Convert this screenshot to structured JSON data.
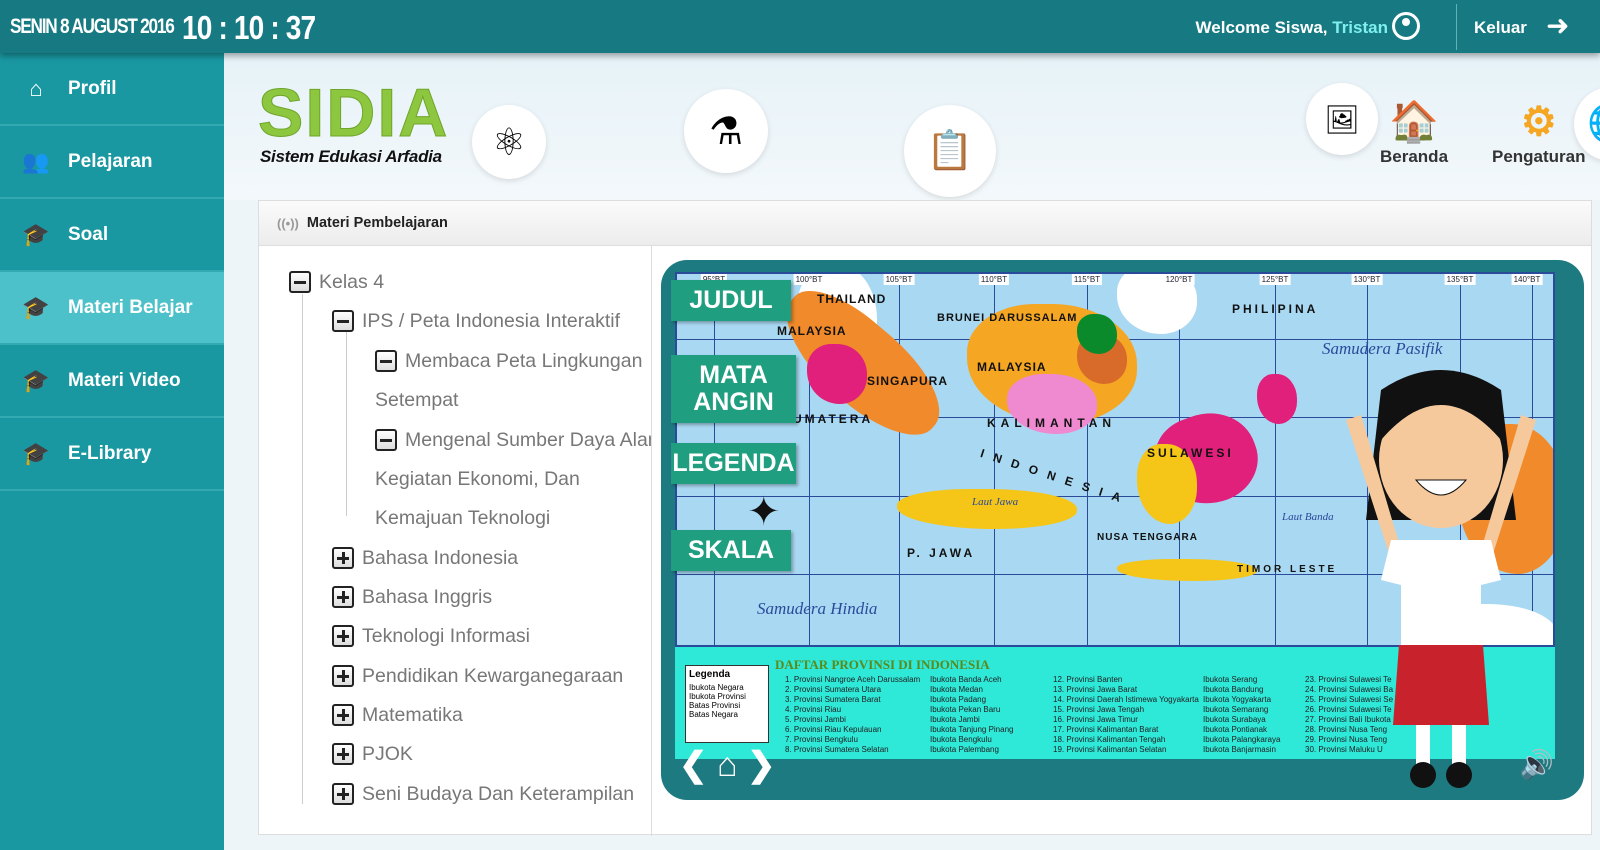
{
  "topbar": {
    "date": "SENIN 8 AUGUST 2016",
    "time": "10 : 10 : 37",
    "welcome_prefix": "Welcome Siswa, ",
    "user_name": "Tristan",
    "logout_label": "Keluar"
  },
  "sidebar": {
    "items": [
      {
        "label": "Profil",
        "icon": "home-icon"
      },
      {
        "label": "Pelajaran",
        "icon": "users-icon"
      },
      {
        "label": "Soal",
        "icon": "graduation-cap-icon"
      },
      {
        "label": "Materi Belajar",
        "icon": "graduation-cap-icon",
        "active": true
      },
      {
        "label": "Materi Video",
        "icon": "graduation-cap-icon"
      },
      {
        "label": "E-Library",
        "icon": "graduation-cap-icon"
      }
    ]
  },
  "header": {
    "logo": "SIDIA",
    "tagline": "Sistem Edukasi Arfadia",
    "nav": [
      {
        "label": "Beranda",
        "icon": "house-icon"
      },
      {
        "label": "Pengaturan",
        "icon": "gear-icon"
      }
    ]
  },
  "panel": {
    "title": "Materi Pembelajaran",
    "tree": [
      {
        "label": "Kelas 4",
        "state": "expanded",
        "level": 0
      },
      {
        "label": "IPS / Peta Indonesia Interaktif",
        "state": "expanded",
        "level": 1
      },
      {
        "label": "Membaca Peta Lingkungan",
        "state": "expanded",
        "level": 2
      },
      {
        "label": "Setempat",
        "level": 2,
        "continuation": true
      },
      {
        "label": "Mengenal Sumber Daya Alam",
        "state": "expanded",
        "level": 2
      },
      {
        "label": "Kegiatan Ekonomi, Dan",
        "level": 2,
        "continuation": true
      },
      {
        "label": "Kemajuan Teknologi",
        "level": 2,
        "continuation": true
      },
      {
        "label": "Bahasa Indonesia",
        "state": "collapsed",
        "level": 1
      },
      {
        "label": "Bahasa Inggris",
        "state": "collapsed",
        "level": 1
      },
      {
        "label": "Teknologi Informasi",
        "state": "collapsed",
        "level": 1
      },
      {
        "label": "Pendidikan Kewarganegaraan",
        "state": "collapsed",
        "level": 1
      },
      {
        "label": "Matematika",
        "state": "collapsed",
        "level": 1
      },
      {
        "label": "PJOK",
        "state": "collapsed",
        "level": 1
      },
      {
        "label": "Seni Budaya Dan Keterampilan",
        "state": "collapsed",
        "level": 1
      }
    ]
  },
  "viewer": {
    "buttons": [
      "JUDUL",
      "MATA ANGIN",
      "LEGENDA",
      "SKALA"
    ],
    "map_labels": {
      "thailand": "THAILAND",
      "malaysia1": "MALAYSIA",
      "brunei": "BRUNEI DARUSSALAM",
      "malaysia2": "MALAYSIA",
      "singapura": "SINGAPURA",
      "philipina": "PHILIPINA",
      "sumatera": "SUMATERA",
      "kalimantan": "KALIMANTAN",
      "sulawesi": "SULAWESI",
      "indonesia": "INDONESIA",
      "jawa": "P. JAWA",
      "timor": "TIMOR LESTE",
      "nusa": "NUSA TENGGARA",
      "pasifik": "Samudera Pasifik",
      "hindia": "Samudera Hindia",
      "banda": "Laut Banda",
      "jawa_sea": "Laut Jawa"
    },
    "longitudes": [
      "95°BT",
      "100°BT",
      "105°BT",
      "110°BT",
      "115°BT",
      "120°BT",
      "125°BT",
      "130°BT",
      "135°BT",
      "140°BT"
    ],
    "list_title": "DAFTAR PROVINSI DI INDONESIA",
    "legend": {
      "title": "Legenda",
      "items": [
        "Ibukota Negara",
        "Ibukota Provinsi",
        "Batas Provinsi",
        "Batas Negara"
      ]
    },
    "provinces_col1": [
      "1. Provinsi Nangroe Aceh Darussalam",
      "2. Provinsi Sumatera Utara",
      "3. Provinsi Sumatera Barat",
      "4. Provinsi Riau",
      "5. Provinsi Jambi",
      "6. Provinsi Riau Kepulauan",
      "7. Provinsi Bengkulu",
      "8. Provinsi Sumatera Selatan"
    ],
    "capitals_col1": [
      "Ibukota Banda Aceh",
      "Ibukota Medan",
      "Ibukota Padang",
      "Ibukota Pekan Baru",
      "Ibukota Jambi",
      "Ibukota Tanjung Pinang",
      "Ibukota Bengkulu",
      "Ibukota Palembang"
    ],
    "provinces_col2": [
      "12. Provinsi Banten",
      "13. Provinsi Jawa Barat",
      "14. Provinsi Daerah Istimewa Yogyakarta",
      "15. Provinsi Jawa Tengah",
      "16. Provinsi Jawa Timur",
      "17. Provinsi Kalimantan Barat",
      "18. Provinsi Kalimantan Tengah",
      "19. Provinsi Kalimantan Selatan"
    ],
    "capitals_col2": [
      "Ibukota Serang",
      "Ibukota Bandung",
      "Ibukota Yogyakarta",
      "Ibukota Semarang",
      "Ibukota Surabaya",
      "Ibukota Pontianak",
      "Ibukota Palangkaraya",
      "Ibukota Banjarmasin"
    ],
    "provinces_col3": [
      "23. Provinsi Sulawesi Te",
      "24. Provinsi Sulawesi Ba",
      "25. Provinsi Sulawesi Se",
      "26. Provinsi Sulawesi Te",
      "27. Provinsi Bali Ibukota",
      "28. Provinsi Nusa Teng",
      "29. Provinsi Nusa Teng",
      "30. Provinsi Maluku U"
    ]
  },
  "colors": {
    "topbar": "#177a82",
    "sidebar": "#1a98a2",
    "sidebar_active": "#4cc1c9",
    "frame": "#1d7a80",
    "map_button": "#1f9e80",
    "logo": "#8dc63f"
  }
}
